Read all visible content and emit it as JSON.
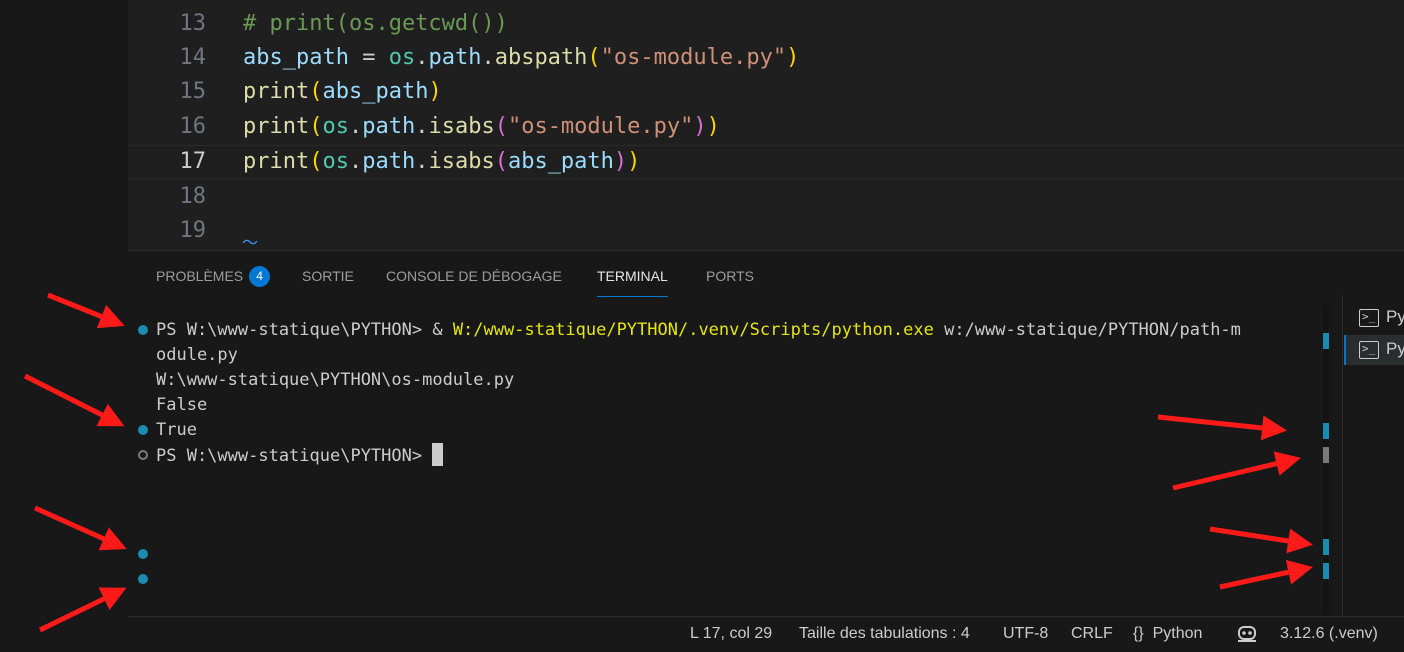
{
  "editor": {
    "lines": [
      {
        "num": "13",
        "text": "# print(os.getcwd())"
      },
      {
        "num": "14",
        "text": "abs_path = os.path.abspath(\"os-module.py\")"
      },
      {
        "num": "15",
        "text": "print(abs_path)"
      },
      {
        "num": "16",
        "text": "print(os.path.isabs(\"os-module.py\"))"
      },
      {
        "num": "17",
        "text": "print(os.path.isabs(abs_path))"
      },
      {
        "num": "18",
        "text": ""
      },
      {
        "num": "19",
        "text": ""
      }
    ],
    "active_line": "17"
  },
  "panel": {
    "tabs": [
      {
        "label": "PROBLÈMES",
        "badge": "4"
      },
      {
        "label": "SORTIE"
      },
      {
        "label": "CONSOLE DE DÉBOGAGE"
      },
      {
        "label": "TERMINAL",
        "active": true
      },
      {
        "label": "PORTS"
      }
    ],
    "terminal": {
      "lines": [
        {
          "prefix": "PS W:\\www-statique\\PYTHON> & ",
          "highlight": "W:/www-statique/PYTHON/.venv/Scripts/python.exe",
          "suffix": " w:/www-statique/PYTHON/path-m"
        },
        {
          "text": "odule.py"
        },
        {
          "text": "W:\\www-statique\\PYTHON\\os-module.py"
        },
        {
          "text": "False"
        },
        {
          "text": "True"
        },
        {
          "text": "PS W:\\www-statique\\PYTHON> "
        }
      ]
    },
    "terminal_list": [
      {
        "label": "Py",
        "icon": "terminal-icon"
      },
      {
        "label": "Py",
        "icon": "terminal-icon",
        "selected": true
      }
    ]
  },
  "status_bar": {
    "position": "L 17, col 29",
    "tab_size": "Taille des tabulations : 4",
    "encoding": "UTF-8",
    "eol": "CRLF",
    "language_icon": "{}",
    "language": "Python",
    "copilot_icon": "copilot-icon",
    "interpreter": "3.12.6 (.venv)"
  },
  "colors": {
    "accent": "#0078d4",
    "success_decoration": "#1a8cb0",
    "annotation_arrow": "#ff1a1a"
  }
}
